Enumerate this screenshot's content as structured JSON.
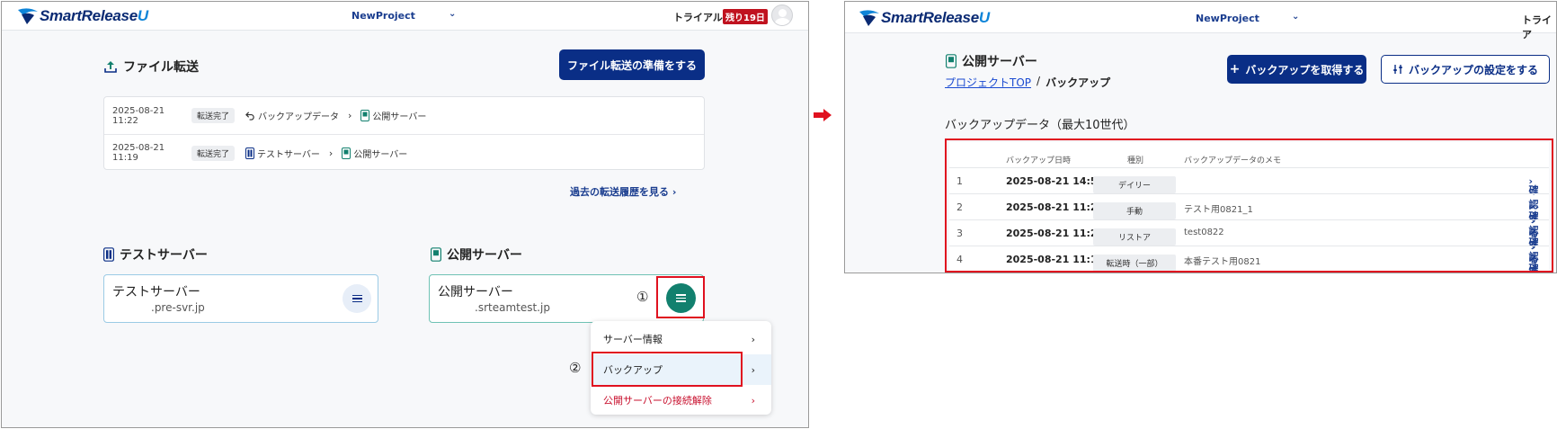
{
  "left": {
    "header": {
      "logo_main": "SmartRelease",
      "logo_u": "U",
      "project": "NewProject",
      "trial": "トライアル",
      "days_left": "残り19日"
    },
    "transfer": {
      "title": "ファイル転送",
      "prepare_button": "ファイル転送の準備をする",
      "rows": [
        {
          "datetime": "2025-08-21 11:22",
          "status": "転送完了",
          "from": "バックアップデータ",
          "to": "公開サーバー"
        },
        {
          "datetime": "2025-08-21 11:19",
          "status": "転送完了",
          "from": "テストサーバー",
          "to": "公開サーバー"
        }
      ],
      "history_link": "過去の転送履歴を見る"
    },
    "test_server": {
      "section_title": "テストサーバー",
      "name": "テストサーバー",
      "host": ".pre-svr.jp"
    },
    "public_server": {
      "section_title": "公開サーバー",
      "name": "公開サーバー",
      "host": ".srteamtest.jp"
    },
    "step1": "①",
    "step2": "②",
    "menu": {
      "items": [
        "サーバー情報",
        "バックアップ",
        "公開サーバーの接続解除"
      ]
    }
  },
  "right": {
    "header": {
      "logo_main": "SmartRelease",
      "logo_u": "U",
      "project": "NewProject",
      "trial_partial": "トライア"
    },
    "server_title": "公開サーバー",
    "breadcrumb": {
      "link": "プロジェクトTOP",
      "sep": "/",
      "current": "バックアップ"
    },
    "get_backup_button": "バックアップを取得する",
    "backup_settings_button": "バックアップの設定をする",
    "table_title": "バックアップデータ（最大10世代）",
    "columns": [
      "バックアップ日時",
      "種別",
      "バックアップデータのメモ"
    ],
    "rows": [
      {
        "no": "1",
        "date": "2025-08-21 14:54",
        "kind": "デイリー",
        "memo": "",
        "action": "確認する"
      },
      {
        "no": "2",
        "date": "2025-08-21 11:22",
        "kind": "手動",
        "memo": "テスト用0821_1",
        "action": "確認する"
      },
      {
        "no": "3",
        "date": "2025-08-21 11:22",
        "kind": "リストア",
        "memo": "test0822",
        "action": "確認する"
      },
      {
        "no": "4",
        "date": "2025-08-21 11:19",
        "kind": "転送時（一部）",
        "memo": "本番テスト用0821",
        "action": "確認する"
      }
    ]
  },
  "colors": {
    "brand_navy": "#0a2e86",
    "teal": "#12806e",
    "highlight_red": "#e0111f",
    "danger": "#c8102e"
  },
  "icons": [
    "upload-icon",
    "undo-icon",
    "server-green-icon",
    "server-blue-icon",
    "hamburger-icon",
    "chevron-right-icon",
    "chevron-down-icon",
    "plus-icon",
    "sliders-icon",
    "avatar-icon",
    "red-arrow-icon"
  ]
}
